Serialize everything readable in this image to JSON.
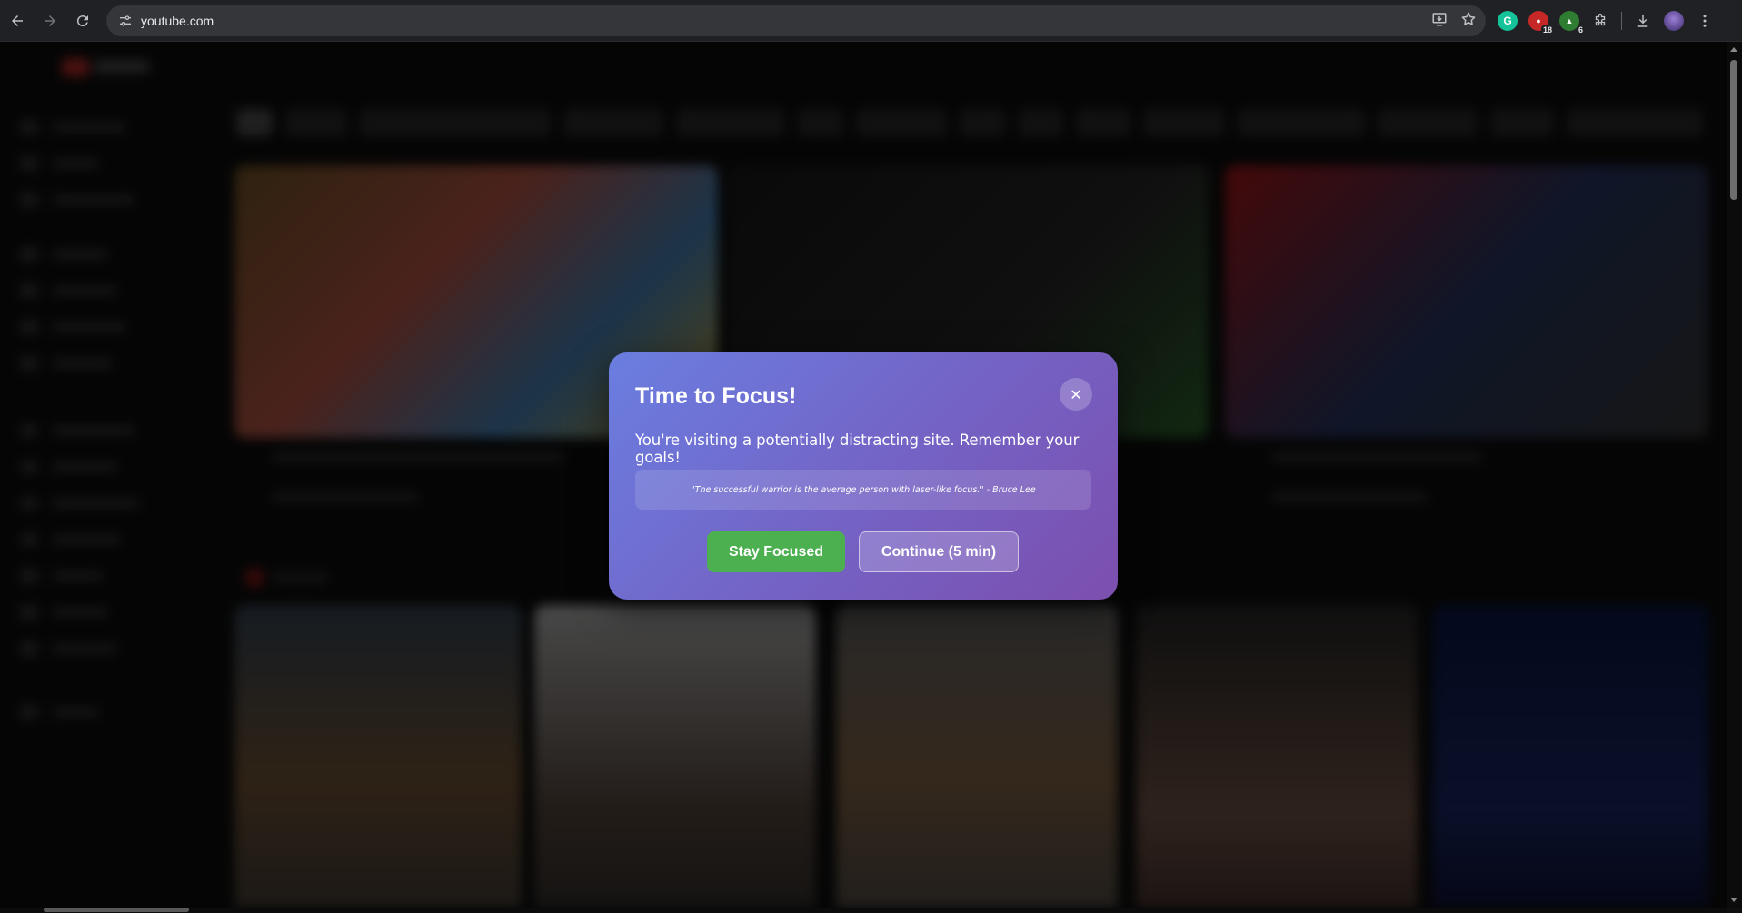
{
  "browser": {
    "url": "youtube.com",
    "extensions": [
      {
        "name": "grammarly-icon",
        "color": "#15c39a",
        "badge": ""
      },
      {
        "name": "extension-red-icon",
        "color": "#c62828",
        "badge": "18"
      },
      {
        "name": "extension-green-icon",
        "color": "#2e7d32",
        "badge": "6"
      }
    ]
  },
  "modal": {
    "title": "Time to Focus!",
    "close_label": "✕",
    "message": "You're visiting a potentially distracting site. Remember your goals!",
    "quote": "\"The successful warrior is the average person with laser-like focus.\" - Bruce Lee",
    "stay_label": "Stay Focused",
    "continue_label": "Continue (5 min)"
  },
  "colors": {
    "modal_gradient_start": "#6a7ee0",
    "modal_gradient_end": "#7c4fae",
    "stay_button": "#4caf50"
  }
}
